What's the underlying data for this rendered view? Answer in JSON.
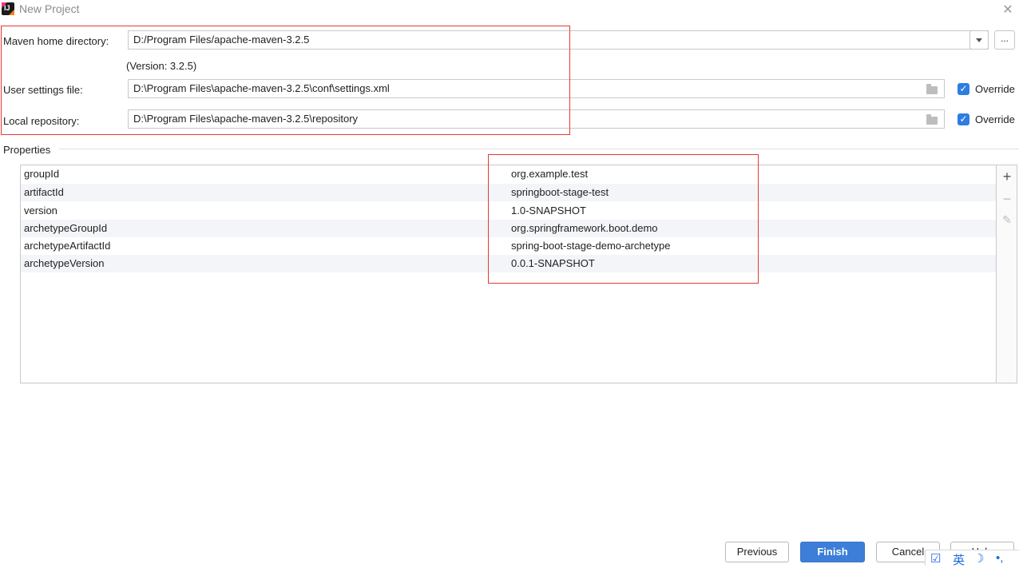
{
  "window": {
    "title": "New Project"
  },
  "maven": {
    "home_label": "Maven home directory:",
    "home_value": "D:/Program Files/apache-maven-3.2.5",
    "version_text": "(Version: 3.2.5)",
    "settings_label": "User settings file:",
    "settings_value": "D:\\Program Files\\apache-maven-3.2.5\\conf\\settings.xml",
    "settings_override": "Override",
    "repo_label": "Local repository:",
    "repo_value": "D:\\Program Files\\apache-maven-3.2.5\\repository",
    "repo_override": "Override",
    "browse_label": "..."
  },
  "properties": {
    "label": "Properties",
    "rows": [
      {
        "key": "groupId",
        "value": "org.example.test"
      },
      {
        "key": "artifactId",
        "value": "springboot-stage-test"
      },
      {
        "key": "version",
        "value": "1.0-SNAPSHOT"
      },
      {
        "key": "archetypeGroupId",
        "value": "org.springframework.boot.demo"
      },
      {
        "key": "archetypeArtifactId",
        "value": "spring-boot-stage-demo-archetype"
      },
      {
        "key": "archetypeVersion",
        "value": "0.0.1-SNAPSHOT"
      }
    ],
    "tools": {
      "add": "+",
      "remove": "−",
      "edit": "✎"
    }
  },
  "buttons": {
    "previous": "Previous",
    "finish": "Finish",
    "cancel": "Cancel",
    "help": "Help"
  },
  "ime": {
    "lang": "英",
    "moon": "☽",
    "dots": "•,"
  },
  "colors": {
    "accent": "#3d7ed8",
    "highlight": "#e53935",
    "row_alt": "#f3f5f9"
  },
  "icons": [
    "app-icon",
    "close-icon",
    "dropdown-icon",
    "folder-icon",
    "checkbox-checked-icon",
    "add-icon",
    "remove-icon",
    "edit-icon"
  ]
}
